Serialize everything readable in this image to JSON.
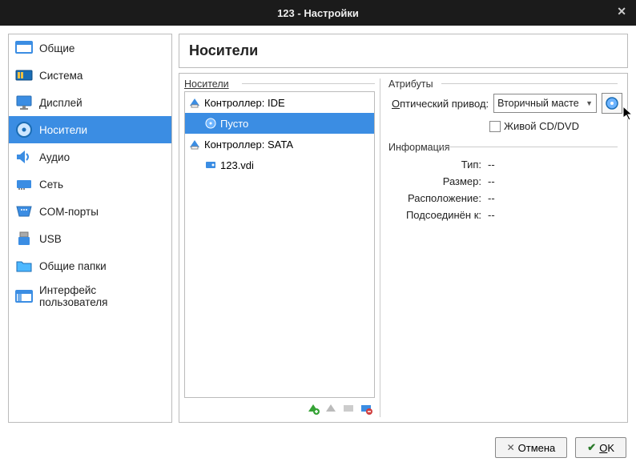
{
  "window": {
    "title": "123 - Настройки"
  },
  "sidebar": {
    "items": [
      {
        "id": "general",
        "label": "Общие"
      },
      {
        "id": "system",
        "label": "Система"
      },
      {
        "id": "display",
        "label": "Дисплей"
      },
      {
        "id": "storage",
        "label": "Носители",
        "selected": true
      },
      {
        "id": "audio",
        "label": "Аудио"
      },
      {
        "id": "network",
        "label": "Сеть"
      },
      {
        "id": "serial",
        "label": "COM-порты"
      },
      {
        "id": "usb",
        "label": "USB"
      },
      {
        "id": "shared",
        "label": "Общие папки"
      },
      {
        "id": "ui",
        "label": "Интерфейс пользователя"
      }
    ]
  },
  "page": {
    "title": "Носители",
    "tree_label": "Носители",
    "attr_label": "Атрибуты",
    "tree": {
      "controller1": "Контроллер: IDE",
      "empty": "Пусто",
      "controller2": "Контроллер: SATA",
      "disk": "123.vdi"
    },
    "attributes": {
      "optical_drive_label": "Оптический привод:",
      "optical_drive_value": "Вторичный масте",
      "live_cd_label": "Живой CD/DVD"
    },
    "info_label": "Информация",
    "info": {
      "type_label": "Тип:",
      "type_value": "--",
      "size_label": "Размер:",
      "size_value": "--",
      "location_label": "Расположение:",
      "location_value": "--",
      "attached_label": "Подсоединён к:",
      "attached_value": "--"
    }
  },
  "footer": {
    "cancel": "Отмена",
    "ok": "OK"
  }
}
